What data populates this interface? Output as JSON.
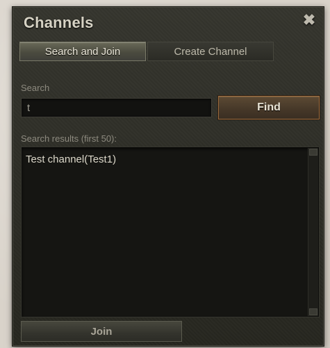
{
  "window": {
    "title": "Channels",
    "close_glyph": "✖"
  },
  "tabs": [
    {
      "label": "Search and Join",
      "active": true
    },
    {
      "label": "Create Channel",
      "active": false
    }
  ],
  "search": {
    "label": "Search",
    "value": "t",
    "find_label": "Find"
  },
  "results": {
    "label": "Search results (first 50):",
    "items": [
      {
        "label": "Test channel(Test1)"
      }
    ]
  },
  "join_label": "Join",
  "colors": {
    "window_bg": "#2c2c26",
    "find_border": "#9a6a3c",
    "text_light": "#dcd8ca"
  }
}
